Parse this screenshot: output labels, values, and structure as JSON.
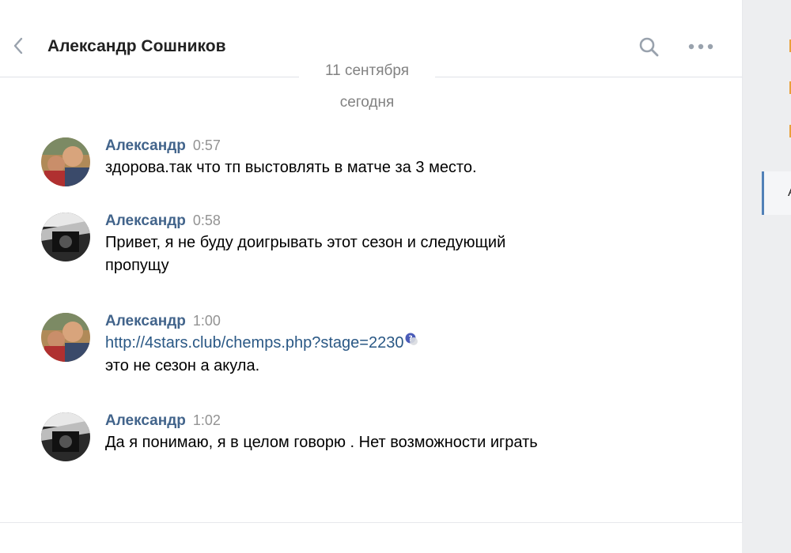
{
  "header": {
    "peer_name": "Александр Сошников"
  },
  "date_separator": "11 сентября",
  "today_label": "сегодня",
  "messages": [
    {
      "author": "Александр",
      "time": "0:57",
      "lines": [
        "здорова.так что тп выстовлять в матче за 3 место."
      ]
    },
    {
      "author": "Александр",
      "time": "0:58",
      "lines": [
        "Привет, я не буду доигрывать этот сезон и следующий",
        "пропущу"
      ]
    },
    {
      "author": "Александр",
      "time": "1:00",
      "link": "http://4stars.club/chemps.php?stage=2230",
      "lines": [
        "это не сезон а акула."
      ]
    },
    {
      "author": "Александр",
      "time": "1:02",
      "lines": [
        "Да я понимаю, я в целом говорю . Нет возможности играть"
      ]
    }
  ],
  "colors": {
    "author": "#42648b",
    "link": "#2a5885",
    "muted": "#828282",
    "accent": "#5181b8"
  },
  "icons": [
    "back-icon",
    "search-icon",
    "more-icon",
    "help-icon"
  ]
}
